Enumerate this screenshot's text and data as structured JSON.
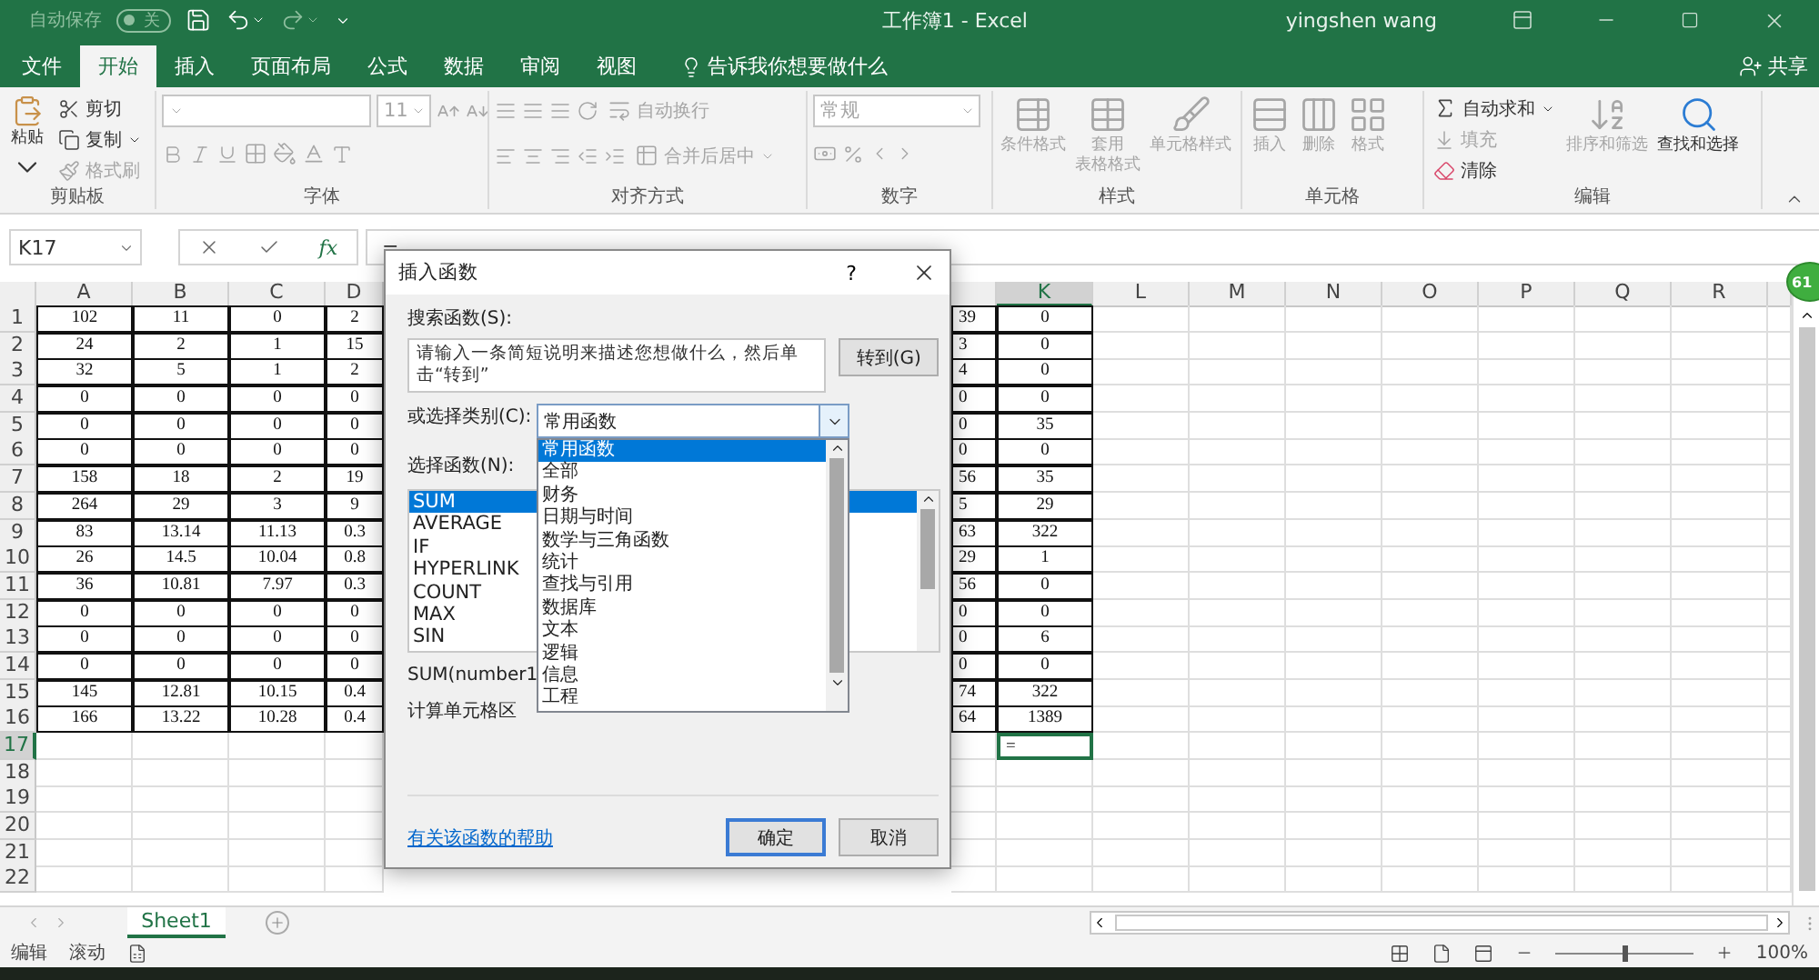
{
  "title_bar": {
    "autosave_label": "自动保存",
    "autosave": {
      "label": "关",
      "on": false
    },
    "title": "工作簿1  -  Excel",
    "user": "yingshen wang"
  },
  "tabs": [
    {
      "label": "文件",
      "selected": false
    },
    {
      "label": "开始",
      "selected": true
    },
    {
      "label": "插入",
      "selected": false
    },
    {
      "label": "页面布局",
      "selected": false
    },
    {
      "label": "公式",
      "selected": false
    },
    {
      "label": "数据",
      "selected": false
    },
    {
      "label": "审阅",
      "selected": false
    },
    {
      "label": "视图",
      "selected": false
    }
  ],
  "tell_me": "告诉我你想要做什么",
  "share": "共享",
  "ribbon": {
    "clipboard": {
      "label": "剪贴板",
      "paste": {
        "label": "粘贴",
        "disabled": false
      },
      "cut": {
        "label": "剪切",
        "disabled": false
      },
      "copy": {
        "label": "复制",
        "disabled": false
      },
      "format_painter": {
        "label": "格式刷",
        "disabled": true
      }
    },
    "font": {
      "label": "字体",
      "size": "11",
      "disabled": true
    },
    "alignment": {
      "label": "对齐方式",
      "wrap_text": "自动换行",
      "merge": "合并后居中",
      "disabled": true
    },
    "number": {
      "label": "数字",
      "format": "常规",
      "disabled": true
    },
    "styles": {
      "label": "样式",
      "conditional": "条件格式",
      "table_lines": [
        "套用",
        "表格格式"
      ],
      "cell_styles": "单元格样式",
      "disabled": true
    },
    "cells": {
      "label": "单元格",
      "insert": "插入",
      "delete": "删除",
      "format": "格式",
      "disabled": true
    },
    "editing": {
      "label": "编辑",
      "autosum": {
        "label": "自动求和",
        "disabled": false
      },
      "fill": {
        "label": "填充",
        "disabled": true
      },
      "clear": {
        "label": "清除",
        "disabled": false
      },
      "sort": {
        "label": "排序和筛选",
        "disabled": true
      },
      "find": {
        "label": "查找和选择",
        "disabled": false
      }
    }
  },
  "formula_bar": {
    "name_box": "K17",
    "fx": "fx",
    "formula": "="
  },
  "sheet": {
    "columns_left": [
      {
        "label": "A",
        "selected": false
      },
      {
        "label": "B",
        "selected": false
      },
      {
        "label": "C",
        "selected": false
      },
      {
        "label": "D",
        "selected": false
      }
    ],
    "columns_right": [
      {
        "label": "K",
        "selected": true
      },
      {
        "label": "L",
        "selected": false
      },
      {
        "label": "M",
        "selected": false
      },
      {
        "label": "N",
        "selected": false
      },
      {
        "label": "O",
        "selected": false
      },
      {
        "label": "P",
        "selected": false
      },
      {
        "label": "Q",
        "selected": false
      },
      {
        "label": "R",
        "selected": false
      }
    ],
    "rows": [
      {
        "number": "1",
        "selected": false,
        "cells": [
          "102",
          "11",
          "0",
          "2"
        ],
        "j": "39",
        "k": "0"
      },
      {
        "number": "2",
        "selected": false,
        "cells": [
          "24",
          "2",
          "1",
          "15"
        ],
        "j": "3",
        "k": "0"
      },
      {
        "number": "3",
        "selected": false,
        "cells": [
          "32",
          "5",
          "1",
          "2"
        ],
        "j": "4",
        "k": "0"
      },
      {
        "number": "4",
        "selected": false,
        "cells": [
          "0",
          "0",
          "0",
          "0"
        ],
        "j": "0",
        "k": "0"
      },
      {
        "number": "5",
        "selected": false,
        "cells": [
          "0",
          "0",
          "0",
          "0"
        ],
        "j": "0",
        "k": "35"
      },
      {
        "number": "6",
        "selected": false,
        "cells": [
          "0",
          "0",
          "0",
          "0"
        ],
        "j": "0",
        "k": "0"
      },
      {
        "number": "7",
        "selected": false,
        "cells": [
          "158",
          "18",
          "2",
          "19"
        ],
        "j": "56",
        "k": "35"
      },
      {
        "number": "8",
        "selected": false,
        "cells": [
          "264",
          "29",
          "3",
          "9"
        ],
        "j": "5",
        "k": "29"
      },
      {
        "number": "9",
        "selected": false,
        "cells": [
          "83",
          "13.14",
          "11.13",
          "0.3"
        ],
        "j": "63",
        "k": "322"
      },
      {
        "number": "10",
        "selected": false,
        "cells": [
          "26",
          "14.5",
          "10.04",
          "0.8"
        ],
        "j": "29",
        "k": "1"
      },
      {
        "number": "11",
        "selected": false,
        "cells": [
          "36",
          "10.81",
          "7.97",
          "0.3"
        ],
        "j": "56",
        "k": "0"
      },
      {
        "number": "12",
        "selected": false,
        "cells": [
          "0",
          "0",
          "0",
          "0"
        ],
        "j": "0",
        "k": "0"
      },
      {
        "number": "13",
        "selected": false,
        "cells": [
          "0",
          "0",
          "0",
          "0"
        ],
        "j": "0",
        "k": "6"
      },
      {
        "number": "14",
        "selected": false,
        "cells": [
          "0",
          "0",
          "0",
          "0"
        ],
        "j": "0",
        "k": "0"
      },
      {
        "number": "15",
        "selected": false,
        "cells": [
          "145",
          "12.81",
          "10.15",
          "0.4"
        ],
        "j": "74",
        "k": "322"
      },
      {
        "number": "16",
        "selected": false,
        "cells": [
          "166",
          "13.22",
          "10.28",
          "0.4"
        ],
        "j": "64",
        "k": "1389"
      },
      {
        "number": "17",
        "selected": true,
        "k": "="
      },
      {
        "number": "18",
        "selected": false
      },
      {
        "number": "19",
        "selected": false
      },
      {
        "number": "20",
        "selected": false
      },
      {
        "number": "21",
        "selected": false
      },
      {
        "number": "22",
        "selected": false
      }
    ]
  },
  "notification_badge": "61",
  "sheet_tabs": [
    {
      "label": "Sheet1",
      "selected": true
    }
  ],
  "status_bar": {
    "mode": "编辑",
    "scroll": "滚动",
    "zoom": "100%",
    "zoom_slider": {
      "level": 0.5
    }
  },
  "dialog": {
    "title": "插入函数",
    "help": "?",
    "search_label": "搜索函数(S):",
    "search_value": "请输入一条简短说明来描述您想做什么，然后单击“转到”",
    "go_button": "转到(G)",
    "category_label": "或选择类别(C):",
    "category_value": "常用函数",
    "category_options": [
      {
        "label": "常用函数",
        "selected": true
      },
      {
        "label": "全部",
        "selected": false
      },
      {
        "label": "财务",
        "selected": false
      },
      {
        "label": "日期与时间",
        "selected": false
      },
      {
        "label": "数学与三角函数",
        "selected": false
      },
      {
        "label": "统计",
        "selected": false
      },
      {
        "label": "查找与引用",
        "selected": false
      },
      {
        "label": "数据库",
        "selected": false
      },
      {
        "label": "文本",
        "selected": false
      },
      {
        "label": "逻辑",
        "selected": false
      },
      {
        "label": "信息",
        "selected": false
      },
      {
        "label": "工程",
        "selected": false
      }
    ],
    "function_label": "选择函数(N):",
    "functions": [
      {
        "label": "SUM",
        "selected": true
      },
      {
        "label": "AVERAGE",
        "selected": false
      },
      {
        "label": "IF",
        "selected": false
      },
      {
        "label": "HYPERLINK",
        "selected": false
      },
      {
        "label": "COUNT",
        "selected": false
      },
      {
        "label": "MAX",
        "selected": false
      },
      {
        "label": "SIN",
        "selected": false
      }
    ],
    "signature": "SUM(number1",
    "description": "计算单元格区",
    "help_link": "有关该函数的帮助",
    "ok": "确定",
    "cancel": "取消"
  }
}
